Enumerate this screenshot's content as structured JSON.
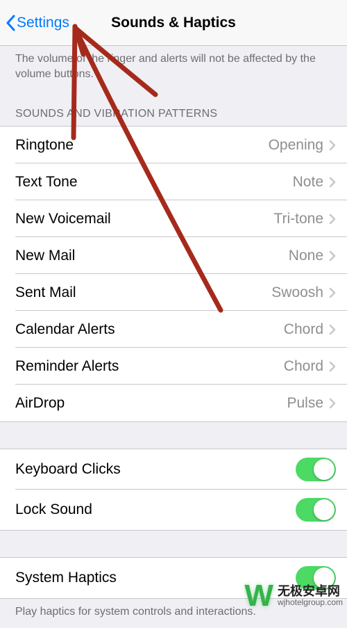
{
  "nav": {
    "back": "Settings",
    "title": "Sounds & Haptics"
  },
  "helper1": "The volume of the ringer and alerts will not be affected by the volume buttons.",
  "section1_header": "SOUNDS AND VIBRATION PATTERNS",
  "sounds": [
    {
      "label": "Ringtone",
      "value": "Opening"
    },
    {
      "label": "Text Tone",
      "value": "Note"
    },
    {
      "label": "New Voicemail",
      "value": "Tri-tone"
    },
    {
      "label": "New Mail",
      "value": "None"
    },
    {
      "label": "Sent Mail",
      "value": "Swoosh"
    },
    {
      "label": "Calendar Alerts",
      "value": "Chord"
    },
    {
      "label": "Reminder Alerts",
      "value": "Chord"
    },
    {
      "label": "AirDrop",
      "value": "Pulse"
    }
  ],
  "toggles1": [
    {
      "label": "Keyboard Clicks",
      "on": true
    },
    {
      "label": "Lock Sound",
      "on": true
    }
  ],
  "toggles2": [
    {
      "label": "System Haptics",
      "on": true
    }
  ],
  "helper2": "Play haptics for system controls and interactions.",
  "watermark": {
    "glyph": "W",
    "cn": "无极安卓网",
    "url": "wjhotelgroup.com"
  }
}
